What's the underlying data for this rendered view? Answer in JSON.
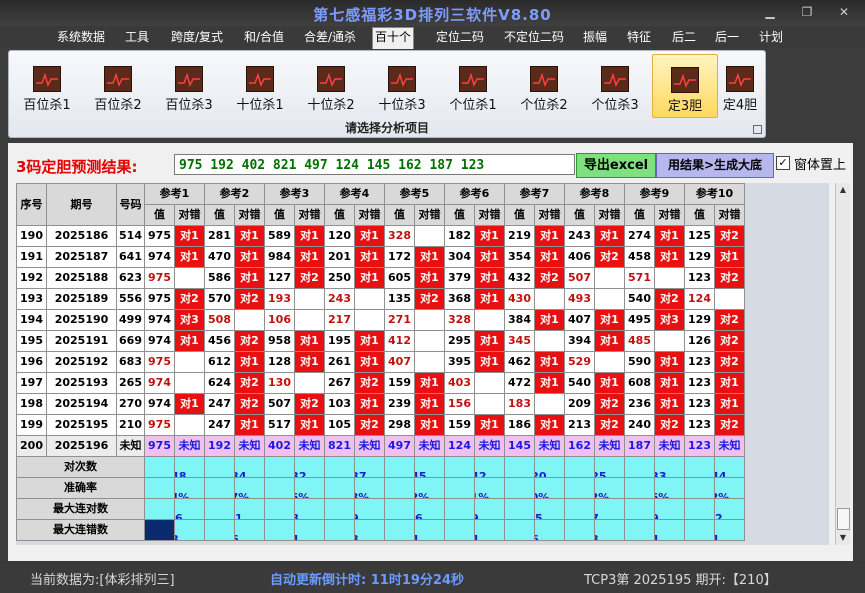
{
  "window": {
    "title": "第七感福彩3D排列三软件V8.80"
  },
  "menu": [
    "系统数据",
    "工具",
    "跨度/复式",
    "和/合值",
    "合差/通杀",
    "百十个",
    "定位二码",
    "不定位二码",
    "振幅",
    "特征",
    "后二",
    "后一",
    "计划"
  ],
  "menu_active": 5,
  "ribbon": {
    "buttons": [
      "百位杀1",
      "百位杀2",
      "百位杀3",
      "十位杀1",
      "十位杀2",
      "十位杀3",
      "个位杀1",
      "个位杀2",
      "个位杀3",
      "定3胆",
      "定4胆"
    ],
    "selected": 9,
    "caption": "请选择分析项目"
  },
  "result": {
    "label": "3码定胆预测结果:",
    "value": "975 192 402 821 497 124 145 162 187 123",
    "excel_button": "导出excel",
    "gen_button": "用结果>生成大底",
    "checkbox_label": "窗体置上",
    "checkbox_checked": true
  },
  "table": {
    "head_fixed": [
      "序号",
      "期号",
      "号码"
    ],
    "groups": [
      "参考1",
      "参考2",
      "参考3",
      "参考4",
      "参考5",
      "参考6",
      "参考7",
      "参考8",
      "参考9",
      "参考10"
    ],
    "sub": [
      "值",
      "对错"
    ],
    "rows": [
      {
        "seq": "190",
        "issue": "2025186",
        "num": "514",
        "cells": [
          [
            "975",
            "对1",
            0
          ],
          [
            "281",
            "对1",
            0
          ],
          [
            "589",
            "对1",
            0
          ],
          [
            "120",
            "对1",
            0
          ],
          [
            "328",
            "",
            1
          ],
          [
            "182",
            "对1",
            0
          ],
          [
            "219",
            "对1",
            0
          ],
          [
            "243",
            "对1",
            0
          ],
          [
            "274",
            "对1",
            0
          ],
          [
            "125",
            "对2",
            0
          ]
        ]
      },
      {
        "seq": "191",
        "issue": "2025187",
        "num": "641",
        "cells": [
          [
            "974",
            "对1",
            0
          ],
          [
            "470",
            "对1",
            0
          ],
          [
            "984",
            "对1",
            0
          ],
          [
            "201",
            "对1",
            0
          ],
          [
            "172",
            "对1",
            0
          ],
          [
            "304",
            "对1",
            0
          ],
          [
            "354",
            "对1",
            0
          ],
          [
            "406",
            "对2",
            0
          ],
          [
            "458",
            "对1",
            0
          ],
          [
            "129",
            "对1",
            0
          ]
        ]
      },
      {
        "seq": "192",
        "issue": "2025188",
        "num": "623",
        "cells": [
          [
            "975",
            "",
            1
          ],
          [
            "586",
            "对1",
            0
          ],
          [
            "127",
            "对2",
            0
          ],
          [
            "250",
            "对1",
            0
          ],
          [
            "605",
            "对1",
            0
          ],
          [
            "379",
            "对1",
            0
          ],
          [
            "432",
            "对2",
            0
          ],
          [
            "507",
            "",
            1
          ],
          [
            "571",
            "",
            1
          ],
          [
            "123",
            "对2",
            0
          ]
        ]
      },
      {
        "seq": "193",
        "issue": "2025189",
        "num": "556",
        "cells": [
          [
            "975",
            "对2",
            0
          ],
          [
            "570",
            "对2",
            0
          ],
          [
            "193",
            "",
            1
          ],
          [
            "243",
            "",
            1
          ],
          [
            "135",
            "对2",
            0
          ],
          [
            "368",
            "对1",
            0
          ],
          [
            "430",
            "",
            1
          ],
          [
            "493",
            "",
            1
          ],
          [
            "540",
            "对2",
            0
          ],
          [
            "124",
            "",
            1
          ]
        ]
      },
      {
        "seq": "194",
        "issue": "2025190",
        "num": "499",
        "cells": [
          [
            "974",
            "对3",
            0
          ],
          [
            "508",
            "",
            1
          ],
          [
            "106",
            "",
            1
          ],
          [
            "217",
            "",
            1
          ],
          [
            "271",
            "",
            1
          ],
          [
            "328",
            "",
            1
          ],
          [
            "384",
            "对1",
            0
          ],
          [
            "407",
            "对1",
            0
          ],
          [
            "495",
            "对3",
            0
          ],
          [
            "129",
            "对2",
            0
          ]
        ]
      },
      {
        "seq": "195",
        "issue": "2025191",
        "num": "669",
        "cells": [
          [
            "974",
            "对1",
            0
          ],
          [
            "456",
            "对2",
            0
          ],
          [
            "958",
            "对1",
            0
          ],
          [
            "195",
            "对1",
            0
          ],
          [
            "412",
            "",
            1
          ],
          [
            "295",
            "对1",
            0
          ],
          [
            "345",
            "",
            1
          ],
          [
            "394",
            "对1",
            0
          ],
          [
            "485",
            "",
            1
          ],
          [
            "126",
            "对2",
            0
          ]
        ]
      },
      {
        "seq": "196",
        "issue": "2025192",
        "num": "683",
        "cells": [
          [
            "975",
            "",
            1
          ],
          [
            "612",
            "对1",
            0
          ],
          [
            "128",
            "对1",
            0
          ],
          [
            "261",
            "对1",
            0
          ],
          [
            "407",
            "",
            1
          ],
          [
            "395",
            "对1",
            0
          ],
          [
            "462",
            "对1",
            0
          ],
          [
            "529",
            "",
            1
          ],
          [
            "590",
            "对1",
            0
          ],
          [
            "123",
            "对2",
            0
          ]
        ]
      },
      {
        "seq": "197",
        "issue": "2025193",
        "num": "265",
        "cells": [
          [
            "974",
            "",
            1
          ],
          [
            "624",
            "对2",
            0
          ],
          [
            "130",
            "",
            1
          ],
          [
            "267",
            "对2",
            0
          ],
          [
            "159",
            "对1",
            0
          ],
          [
            "403",
            "",
            1
          ],
          [
            "472",
            "对1",
            0
          ],
          [
            "540",
            "对1",
            0
          ],
          [
            "608",
            "对1",
            0
          ],
          [
            "123",
            "对1",
            0
          ]
        ]
      },
      {
        "seq": "198",
        "issue": "2025194",
        "num": "270",
        "cells": [
          [
            "974",
            "对1",
            0
          ],
          [
            "247",
            "对2",
            0
          ],
          [
            "507",
            "对2",
            0
          ],
          [
            "103",
            "对1",
            0
          ],
          [
            "239",
            "对1",
            0
          ],
          [
            "156",
            "",
            1
          ],
          [
            "183",
            "",
            1
          ],
          [
            "209",
            "对2",
            0
          ],
          [
            "236",
            "对1",
            0
          ],
          [
            "123",
            "对1",
            0
          ]
        ]
      },
      {
        "seq": "199",
        "issue": "2025195",
        "num": "210",
        "cells": [
          [
            "975",
            "",
            1
          ],
          [
            "247",
            "对1",
            0
          ],
          [
            "517",
            "对1",
            0
          ],
          [
            "105",
            "对2",
            0
          ],
          [
            "298",
            "对1",
            0
          ],
          [
            "159",
            "对1",
            0
          ],
          [
            "186",
            "对1",
            0
          ],
          [
            "213",
            "对2",
            0
          ],
          [
            "240",
            "对2",
            0
          ],
          [
            "123",
            "对2",
            0
          ]
        ]
      }
    ],
    "pred_row": {
      "seq": "200",
      "issue": "2025196",
      "num": "未知",
      "values": [
        "975",
        "192",
        "402",
        "821",
        "497",
        "124",
        "145",
        "162",
        "187",
        "123"
      ],
      "mark": "未知"
    },
    "stats": [
      {
        "label": "对次数",
        "values": [
          "148",
          "134",
          "132",
          "137",
          "145",
          "142",
          "120",
          "125",
          "133",
          "144"
        ]
      },
      {
        "label": "准确率",
        "values": [
          "74%",
          "67%",
          "66%",
          "68%",
          "72%",
          "71%",
          "60%",
          "62%",
          "66%",
          "72%"
        ]
      },
      {
        "label": "最大连对数",
        "values": [
          "16",
          "11",
          "8",
          "9",
          "16",
          "9",
          "15",
          "7",
          "9",
          "12"
        ]
      },
      {
        "label": "最大连错数",
        "values": [
          "3",
          "6",
          "4",
          "3",
          "4",
          "4",
          "6",
          "3",
          "4",
          "4"
        ]
      }
    ]
  },
  "status": {
    "current": "当前数据为:[体彩排列三]",
    "countdown": "自动更新倒计时: 11时19分24秒",
    "draw": "TCP3第 2025195 期开:【210】"
  },
  "colors": {
    "accent_red": "#e81010",
    "cyan": "#7ff5f5",
    "pink": "#f0c0f0",
    "green_text": "#007000"
  }
}
